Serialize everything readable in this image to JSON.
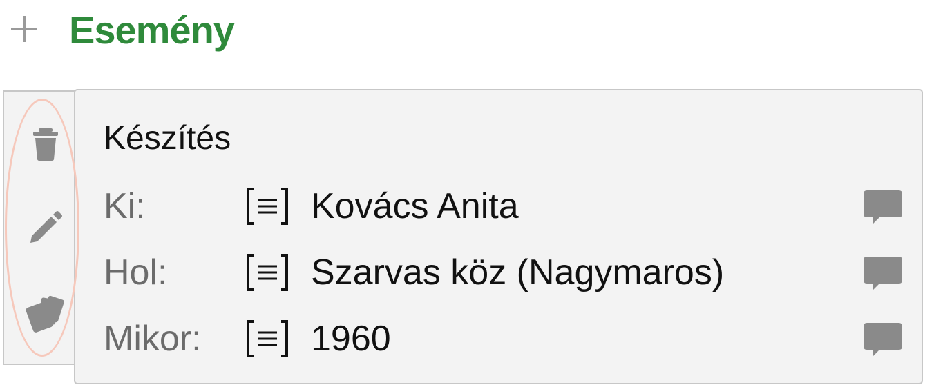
{
  "header": {
    "title": "Esemény",
    "add_icon": "plus-icon"
  },
  "side_actions": [
    {
      "icon": "trash-icon"
    },
    {
      "icon": "pencil-icon"
    },
    {
      "icon": "cards-icon"
    }
  ],
  "card": {
    "title": "Készítés",
    "rows": [
      {
        "label": "Ki:",
        "value": "Kovács Anita",
        "detail_icon": "document-icon",
        "comment_icon": "comment-icon"
      },
      {
        "label": "Hol:",
        "value": "Szarvas köz (Nagymaros)",
        "detail_icon": "document-icon",
        "comment_icon": "comment-icon"
      },
      {
        "label": "Mikor:",
        "value": "1960",
        "detail_icon": "document-icon",
        "comment_icon": "comment-icon"
      }
    ]
  },
  "colors": {
    "title_green": "#2f8a3b",
    "icon_gray": "#8a8a8a",
    "highlight_oval": "#f6c8bb",
    "card_bg": "#f3f3f3",
    "border": "#c7c7c7"
  }
}
